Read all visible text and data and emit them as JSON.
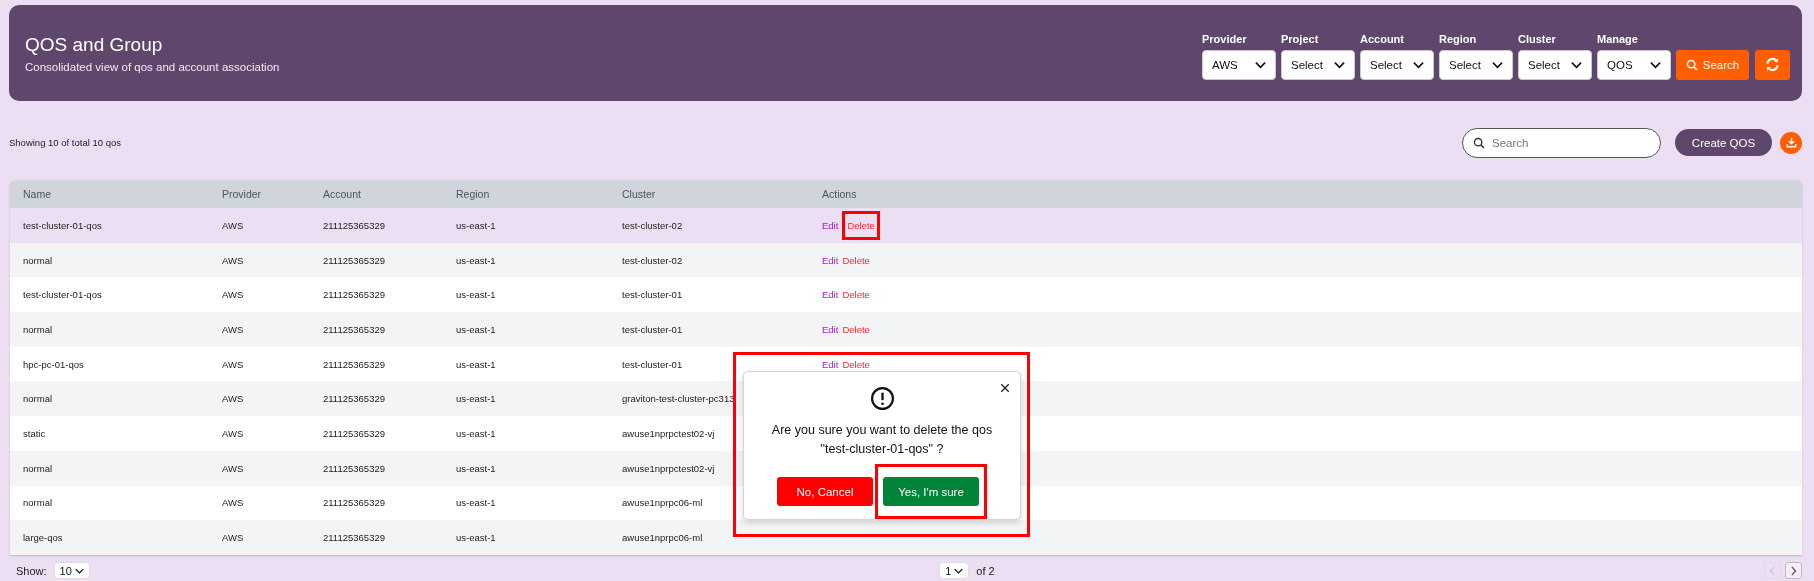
{
  "header": {
    "title": "QOS and Group",
    "subtitle": "Consolidated view of qos and account association"
  },
  "filters": [
    {
      "label": "Provider",
      "value": "AWS"
    },
    {
      "label": "Project",
      "value": "Select"
    },
    {
      "label": "Account",
      "value": "Select"
    },
    {
      "label": "Region",
      "value": "Select"
    },
    {
      "label": "Cluster",
      "value": "Select"
    },
    {
      "label": "Manage",
      "value": "QOS"
    }
  ],
  "search_button": "Search",
  "summary": "Showing 10 of total 10 qos",
  "search": {
    "placeholder": "Search"
  },
  "create_button": "Create QOS",
  "table": {
    "columns": [
      "Name",
      "Provider",
      "Account",
      "Region",
      "Cluster",
      "Actions"
    ],
    "rows": [
      {
        "cells": [
          "test-cluster-01-qos",
          "AWS",
          "211125365329",
          "us-east-1",
          "test-cluster-02"
        ],
        "selected": true,
        "actions": [
          {
            "label": "Edit",
            "kind": "edit",
            "highlighted": false
          },
          {
            "label": "Delete",
            "kind": "delete",
            "highlighted": true
          }
        ]
      },
      {
        "cells": [
          "normal",
          "AWS",
          "211125365329",
          "us-east-1",
          "test-cluster-02"
        ],
        "selected": false,
        "actions": [
          {
            "label": "Edit",
            "kind": "edit",
            "highlighted": false
          },
          {
            "label": "Delete",
            "kind": "delete",
            "highlighted": false
          }
        ]
      },
      {
        "cells": [
          "test-cluster-01-qos",
          "AWS",
          "211125365329",
          "us-east-1",
          "test-cluster-01"
        ],
        "selected": false,
        "actions": [
          {
            "label": "Edit",
            "kind": "edit",
            "highlighted": false
          },
          {
            "label": "Delete",
            "kind": "delete",
            "highlighted": false
          }
        ]
      },
      {
        "cells": [
          "normal",
          "AWS",
          "211125365329",
          "us-east-1",
          "test-cluster-01"
        ],
        "selected": false,
        "actions": [
          {
            "label": "Edit",
            "kind": "edit",
            "highlighted": false
          },
          {
            "label": "Delete",
            "kind": "delete",
            "highlighted": false
          }
        ]
      },
      {
        "cells": [
          "hpc-pc-01-qos",
          "AWS",
          "211125365329",
          "us-east-1",
          "test-cluster-01"
        ],
        "selected": false,
        "actions": [
          {
            "label": "Edit",
            "kind": "edit",
            "highlighted": false
          },
          {
            "label": "Delete",
            "kind": "delete",
            "highlighted": false
          }
        ]
      },
      {
        "cells": [
          "normal",
          "AWS",
          "211125365329",
          "us-east-1",
          "graviton-test-cluster-pc313"
        ],
        "selected": false
      },
      {
        "cells": [
          "static",
          "AWS",
          "211125365329",
          "us-east-1",
          "awuse1nprpctest02-vj"
        ],
        "selected": false
      },
      {
        "cells": [
          "normal",
          "AWS",
          "211125365329",
          "us-east-1",
          "awuse1nprpctest02-vj"
        ],
        "selected": false
      },
      {
        "cells": [
          "normal",
          "AWS",
          "211125365329",
          "us-east-1",
          "awuse1nprpc06-ml"
        ],
        "selected": false
      },
      {
        "cells": [
          "large-qos",
          "AWS",
          "211125365329",
          "us-east-1",
          "awuse1nprpc06-ml"
        ],
        "selected": false
      }
    ]
  },
  "dialog": {
    "highlighted": true,
    "message": "Are you sure you want to delete the qos\n\"test-cluster-01-qos\" ?",
    "cancel": "No, Cancel",
    "confirm": "Yes, I'm sure",
    "confirm_highlighted": true
  },
  "pagination": {
    "show_label": "Show:",
    "page_size": "10",
    "page": "1",
    "of": "of 2",
    "prev_disabled": true,
    "next_disabled": false
  }
}
